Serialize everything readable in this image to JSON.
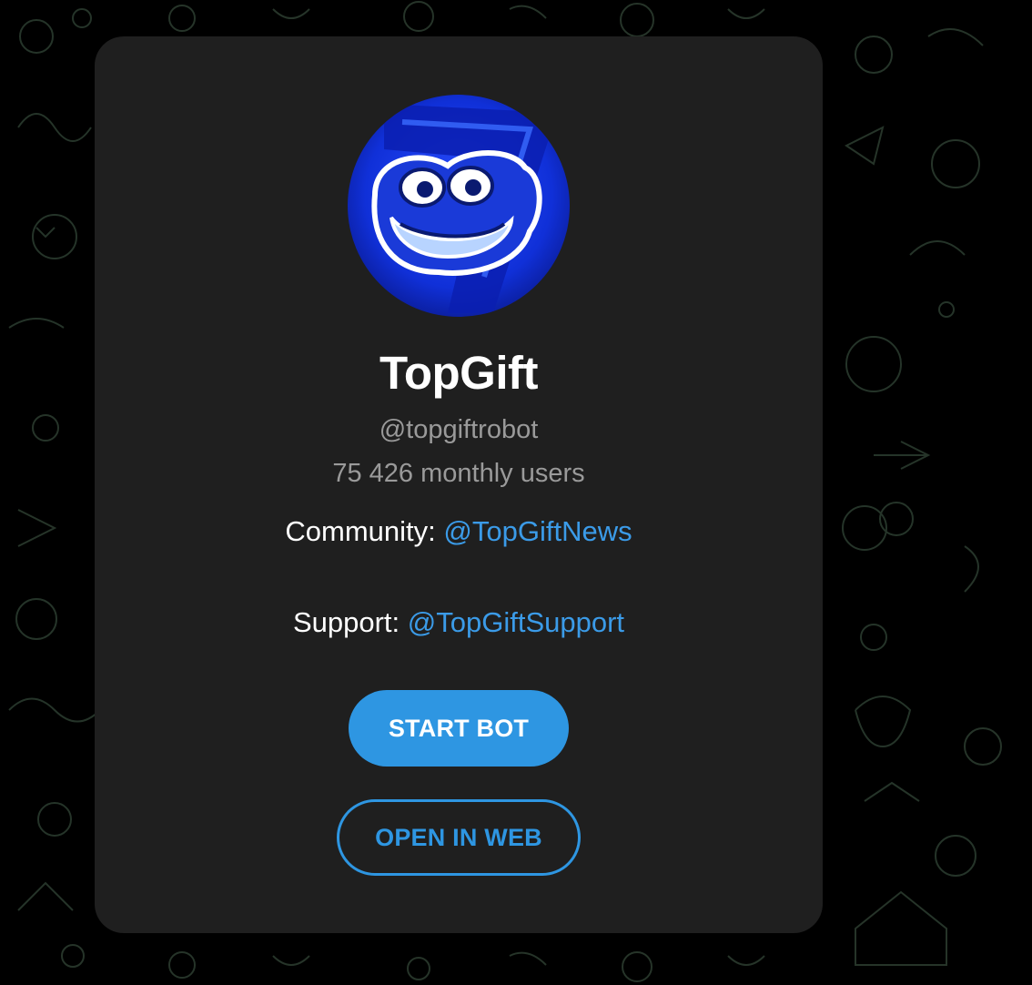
{
  "bot": {
    "name": "TopGift",
    "username": "@topgiftrobot",
    "monthly_users": "75 426 monthly users"
  },
  "description": {
    "community_label": "Community: ",
    "community_link": "@TopGiftNews",
    "support_label": "Support: ",
    "support_link": "@TopGiftSupport"
  },
  "actions": {
    "start_label": "START BOT",
    "open_web_label": "OPEN IN WEB"
  },
  "colors": {
    "background": "#000000",
    "card": "#1f1f1f",
    "accent": "#2e96e2",
    "link": "#3b9be8",
    "muted_text": "#9a9a9a"
  },
  "icons": {
    "avatar": "pepe-frog-avatar",
    "background": "doodle-pattern"
  }
}
